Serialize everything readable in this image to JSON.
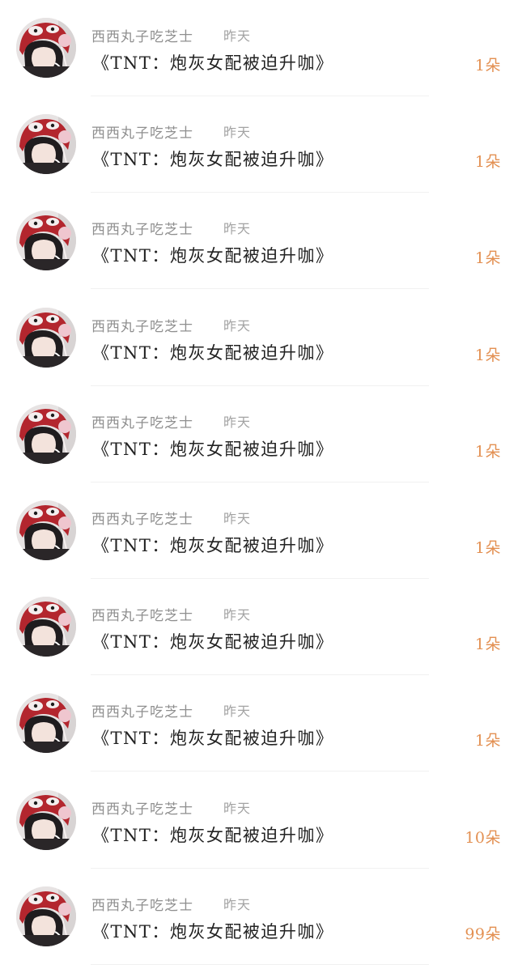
{
  "colors": {
    "username": "#8f8f8f",
    "timestamp": "#a3a3a3",
    "title": "#222222",
    "gift_count": "#e39052",
    "divider": "#f1f1f1",
    "avatar_hood": "#b3262e"
  },
  "records": [
    {
      "username": "西西丸子吃芝士",
      "time": "昨天",
      "title": "《TNT：炮灰女配被迫升咖》",
      "count": "1朵"
    },
    {
      "username": "西西丸子吃芝士",
      "time": "昨天",
      "title": "《TNT：炮灰女配被迫升咖》",
      "count": "1朵"
    },
    {
      "username": "西西丸子吃芝士",
      "time": "昨天",
      "title": "《TNT：炮灰女配被迫升咖》",
      "count": "1朵"
    },
    {
      "username": "西西丸子吃芝士",
      "time": "昨天",
      "title": "《TNT：炮灰女配被迫升咖》",
      "count": "1朵"
    },
    {
      "username": "西西丸子吃芝士",
      "time": "昨天",
      "title": "《TNT：炮灰女配被迫升咖》",
      "count": "1朵"
    },
    {
      "username": "西西丸子吃芝士",
      "time": "昨天",
      "title": "《TNT：炮灰女配被迫升咖》",
      "count": "1朵"
    },
    {
      "username": "西西丸子吃芝士",
      "time": "昨天",
      "title": "《TNT：炮灰女配被迫升咖》",
      "count": "1朵"
    },
    {
      "username": "西西丸子吃芝士",
      "time": "昨天",
      "title": "《TNT：炮灰女配被迫升咖》",
      "count": "1朵"
    },
    {
      "username": "西西丸子吃芝士",
      "time": "昨天",
      "title": "《TNT：炮灰女配被迫升咖》",
      "count": "10朵"
    },
    {
      "username": "西西丸子吃芝士",
      "time": "昨天",
      "title": "《TNT：炮灰女配被迫升咖》",
      "count": "99朵"
    }
  ]
}
